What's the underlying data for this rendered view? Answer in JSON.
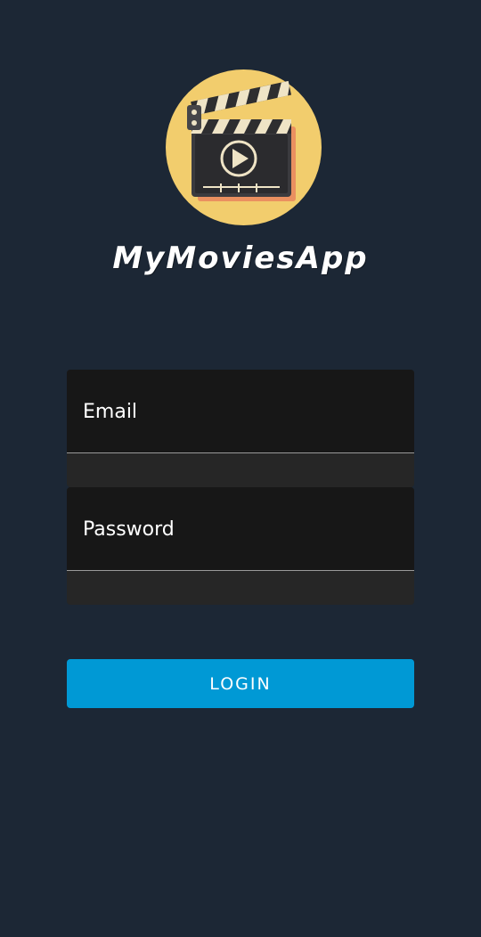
{
  "app": {
    "title": "MyMoviesApp",
    "logo_icon": "movie-clapperboard-icon"
  },
  "form": {
    "email_placeholder": "Email",
    "password_placeholder": "Password",
    "login_label": "LOGIN"
  },
  "colors": {
    "background": "#1c2735",
    "logo_circle": "#f2cd6d",
    "field_background": "#171717",
    "button": "#0099d5",
    "text": "#ffffff"
  }
}
